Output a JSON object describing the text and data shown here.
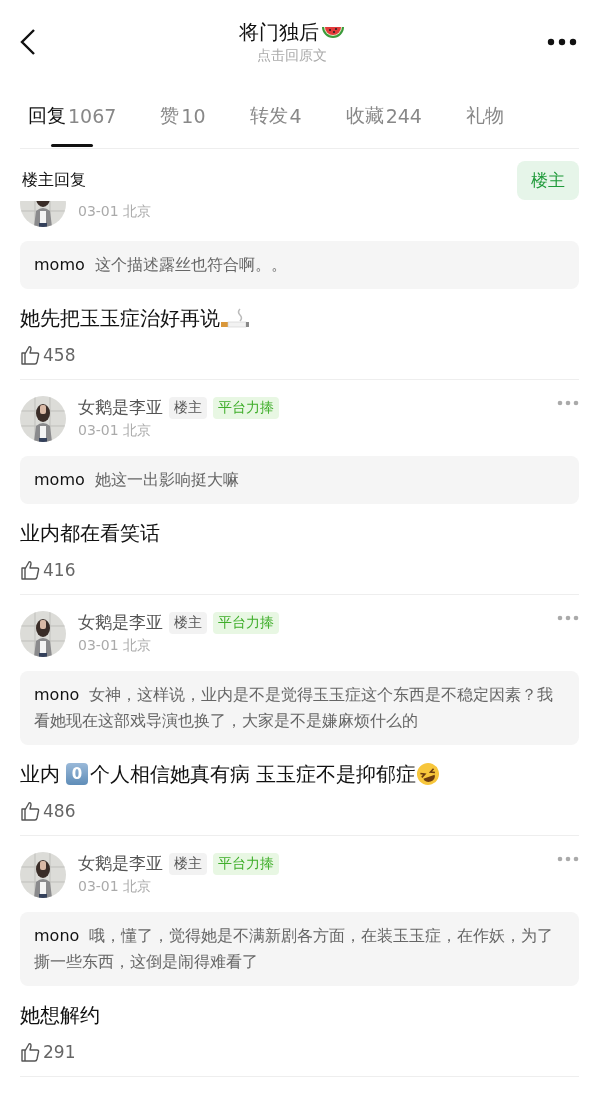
{
  "header": {
    "title": "将门独后",
    "title_icon": {
      "kind": "watermelon"
    },
    "subtitle": "点击回原文"
  },
  "tabs": [
    {
      "label": "回复",
      "count": "1067",
      "selected": true
    },
    {
      "label": "赞",
      "count": "10",
      "selected": false
    },
    {
      "label": "转发",
      "count": "4",
      "selected": false
    },
    {
      "label": "收藏",
      "count": "244",
      "selected": false
    },
    {
      "label": "礼物",
      "selected": false
    }
  ],
  "section": {
    "title": "楼主回复",
    "filter_button": "楼主"
  },
  "posts": [
    {
      "clipped": true,
      "date": "03-01 北京",
      "quote": {
        "user": "momo",
        "text": "这个描述露丝也符合啊。。"
      },
      "content": [
        {
          "kind": "text",
          "text": "她先把玉玉症治好再说"
        },
        {
          "kind": "cigarette"
        }
      ],
      "likes": "458"
    },
    {
      "clipped": false,
      "author": "女鹅是李亚",
      "badges": [
        {
          "kind": "owner",
          "text": "楼主"
        },
        {
          "kind": "promo",
          "text": "平台力捧"
        }
      ],
      "date": "03-01 北京",
      "quote": {
        "user": "momo",
        "text": "她这一出影响挺大嘛"
      },
      "content": [
        {
          "kind": "text",
          "text": "业内都在看笑话"
        }
      ],
      "likes": "416"
    },
    {
      "clipped": false,
      "author": "女鹅是李亚",
      "badges": [
        {
          "kind": "owner",
          "text": "楼主"
        },
        {
          "kind": "promo",
          "text": "平台力捧"
        }
      ],
      "date": "03-01 北京",
      "quote": {
        "user": "mono",
        "text": "女神，这样说，业内是不是觉得玉玉症这个东西是不稳定因素？我看她现在这部戏导演也换了，大家是不是嫌麻烦什么的"
      },
      "content": [
        {
          "kind": "text",
          "text": "业内"
        },
        {
          "kind": "keycap",
          "text": "0"
        },
        {
          "kind": "text",
          "text": "个人相信她真有病 玉玉症不是抑郁症"
        },
        {
          "kind": "laughing"
        }
      ],
      "likes": "486"
    },
    {
      "clipped": false,
      "author": "女鹅是李亚",
      "badges": [
        {
          "kind": "owner",
          "text": "楼主"
        },
        {
          "kind": "promo",
          "text": "平台力捧"
        }
      ],
      "date": "03-01 北京",
      "quote": {
        "user": "mono",
        "text": "哦，懂了，觉得她是不满新剧各方面，在装玉玉症，在作妖，为了撕一些东西，这倒是闹得难看了"
      },
      "content": [
        {
          "kind": "text",
          "text": "她想解约"
        }
      ],
      "likes": "291"
    }
  ]
}
